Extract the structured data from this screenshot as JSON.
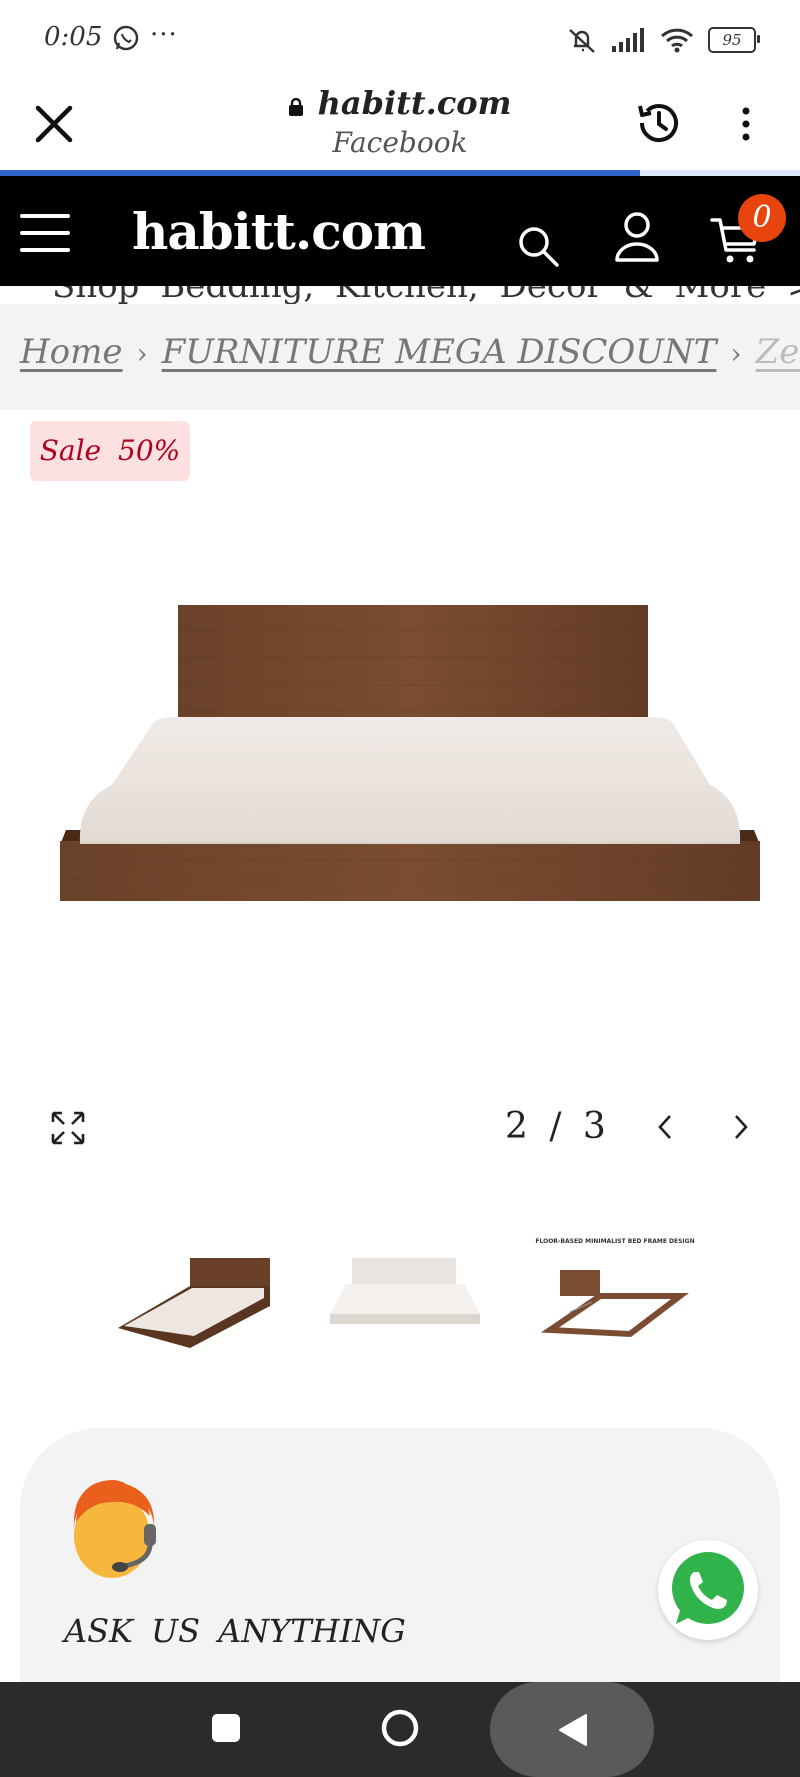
{
  "status_bar": {
    "time": "0:05",
    "more": "···",
    "battery": "95"
  },
  "browser": {
    "domain": "habitt.com",
    "subtitle": "Facebook",
    "progress_percent": 80,
    "accent": "#2e63c8"
  },
  "site_header": {
    "logo": "habitt.com",
    "cart_count": "0",
    "badge_color": "#e8440e"
  },
  "marquee": {
    "text": "Shop Bedding, Kitchen, Decor & More >"
  },
  "breadcrumb": {
    "items": [
      "Home",
      "FURNITURE MEGA DISCOUNT",
      "Zen"
    ],
    "separator": "›"
  },
  "product": {
    "sale_badge": "Sale 50%",
    "gallery_counter": "2 / 3",
    "thumbnails": [
      {
        "name": "bed-thumb-1"
      },
      {
        "name": "bed-thumb-2"
      },
      {
        "name": "bed-thumb-3",
        "caption": "FLOOR-BASED MINIMALIST BED FRAME DESIGN"
      }
    ]
  },
  "chat": {
    "label": "ASK US ANYTHING"
  },
  "icons": {
    "close": "close-icon",
    "history": "history-icon",
    "menu": "more-vert-icon",
    "search": "search-icon",
    "user": "user-icon",
    "cart": "cart-icon",
    "expand": "expand-icon",
    "whatsapp": "whatsapp-icon"
  }
}
